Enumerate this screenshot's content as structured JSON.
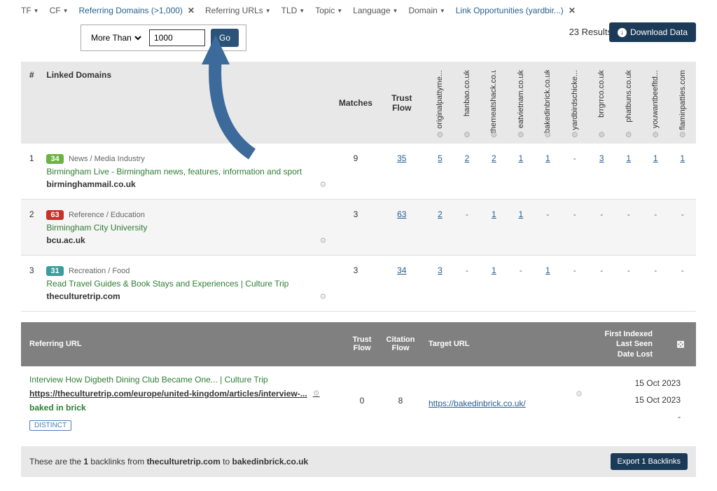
{
  "filters": {
    "tf": "TF",
    "cf": "CF",
    "ref_domains": "Referring Domains (>1,000)",
    "ref_urls": "Referring URLs",
    "tld": "TLD",
    "topic": "Topic",
    "language": "Language",
    "domain": "Domain",
    "link_opps": "Link Opportunities (yardbir...)"
  },
  "input_row": {
    "comparator": "More Than",
    "value": "1000",
    "go": "Go",
    "results": "23 Results",
    "download": "Download Data"
  },
  "headers": {
    "num": "#",
    "linked": "Linked Domains",
    "matches": "Matches",
    "trust_flow": "Trust Flow",
    "vcols": [
      "originalpattyme...",
      "hanbao.co.uk",
      "themeatshack.co.uk",
      "eatvietnam.co.uk",
      "bakedinbrick.co.uk",
      "yardbirdschicke...",
      "brrgrrco.co.uk",
      "phatbuns.co.uk",
      "youwantbeefltd...",
      "flaminpatties.com"
    ]
  },
  "rows": [
    {
      "num": "1",
      "badge": "34",
      "badge_color": "green",
      "category": "News / Media Industry",
      "title": "Birmingham Live - Birmingham news, features, information and sport",
      "domain": "birminghammail.co.uk",
      "matches": "9",
      "tf": "35",
      "vals": [
        "5",
        "2",
        "2",
        "1",
        "1",
        "-",
        "3",
        "1",
        "1",
        "1"
      ]
    },
    {
      "num": "2",
      "badge": "63",
      "badge_color": "red",
      "category": "Reference / Education",
      "title": "Birmingham City University",
      "domain": "bcu.ac.uk",
      "matches": "3",
      "tf": "63",
      "vals": [
        "2",
        "-",
        "1",
        "1",
        "-",
        "-",
        "-",
        "-",
        "-",
        "-"
      ]
    },
    {
      "num": "3",
      "badge": "31",
      "badge_color": "teal",
      "category": "Recreation / Food",
      "title": "Read Travel Guides & Book Stays and Experiences | Culture Trip",
      "domain": "theculturetrip.com",
      "matches": "3",
      "tf": "34",
      "vals": [
        "3",
        "-",
        "1",
        "-",
        "1",
        "-",
        "-",
        "-",
        "-",
        "-"
      ]
    }
  ],
  "sub": {
    "header": {
      "refurl": "Referring URL",
      "tf": "Trust Flow",
      "cf": "Citation Flow",
      "target": "Target URL",
      "first_indexed": "First Indexed",
      "last_seen": "Last Seen",
      "date_lost": "Date Lost"
    },
    "body": {
      "title": "Interview How Digbeth Dining Club Became One... | Culture Trip",
      "url": "https://theculturetrip.com/europe/united-kingdom/articles/interview-...",
      "anchor": "baked in brick",
      "distinct": "DISTINCT",
      "tf": "0",
      "cf": "8",
      "target_url": "https://bakedinbrick.co.uk/",
      "date1": "15 Oct 2023",
      "date2": "15 Oct 2023",
      "date3": "-"
    }
  },
  "footer": {
    "text_pre": "These are the ",
    "count": "1",
    "text_mid": " backlinks from ",
    "from": "theculturetrip.com",
    "text_to": " to ",
    "to": "bakedinbrick.co.uk",
    "export": "Export 1 Backlinks"
  }
}
